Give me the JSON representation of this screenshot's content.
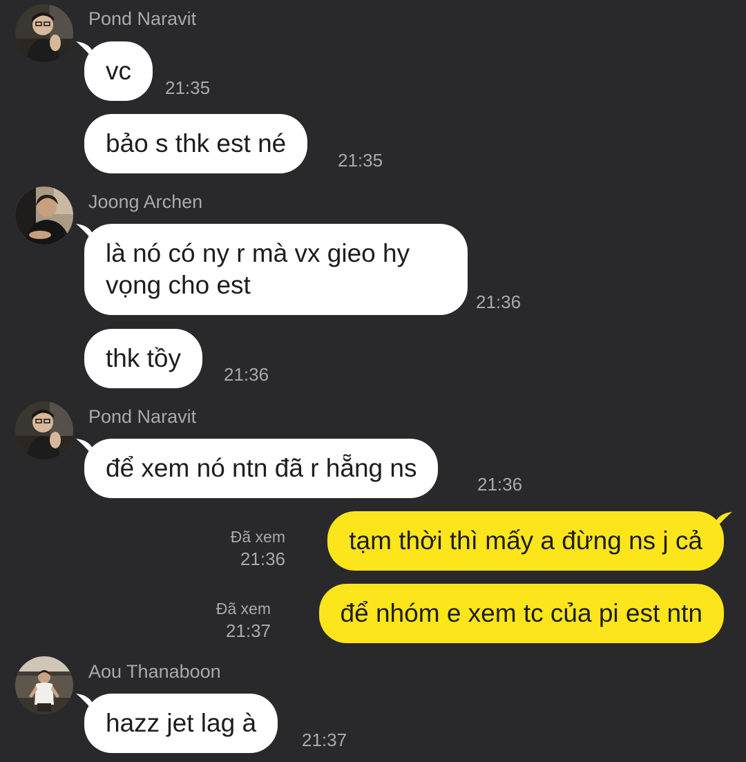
{
  "conversation": {
    "messages": [
      {
        "sender": "Pond Naravit",
        "text": "vc",
        "time": "21:35"
      },
      {
        "text": "bảo s thk est né",
        "time": "21:35"
      },
      {
        "sender": "Joong Archen",
        "text": "là nó có ny r mà vx gieo hy vọng cho est",
        "time": "21:36"
      },
      {
        "text": "thk tồy",
        "time": "21:36"
      },
      {
        "sender": "Pond Naravit",
        "text": "để xem nó ntn đã r hẵng ns",
        "time": "21:36"
      },
      {
        "mine": true,
        "text": "tạm thời thì mấy a đừng ns j cả",
        "status": "Đã xem",
        "time": "21:36"
      },
      {
        "mine": true,
        "text": "để nhóm e xem tc của pi est ntn",
        "status": "Đã xem",
        "time": "21:37"
      },
      {
        "sender": "Aou Thanaboon",
        "text": "hazz jet lag à",
        "time": "21:37"
      }
    ]
  },
  "colors": {
    "background": "#29292b",
    "incoming_bubble": "#ffffff",
    "outgoing_bubble": "#fde51b",
    "meta_text": "#a9a9ae"
  }
}
